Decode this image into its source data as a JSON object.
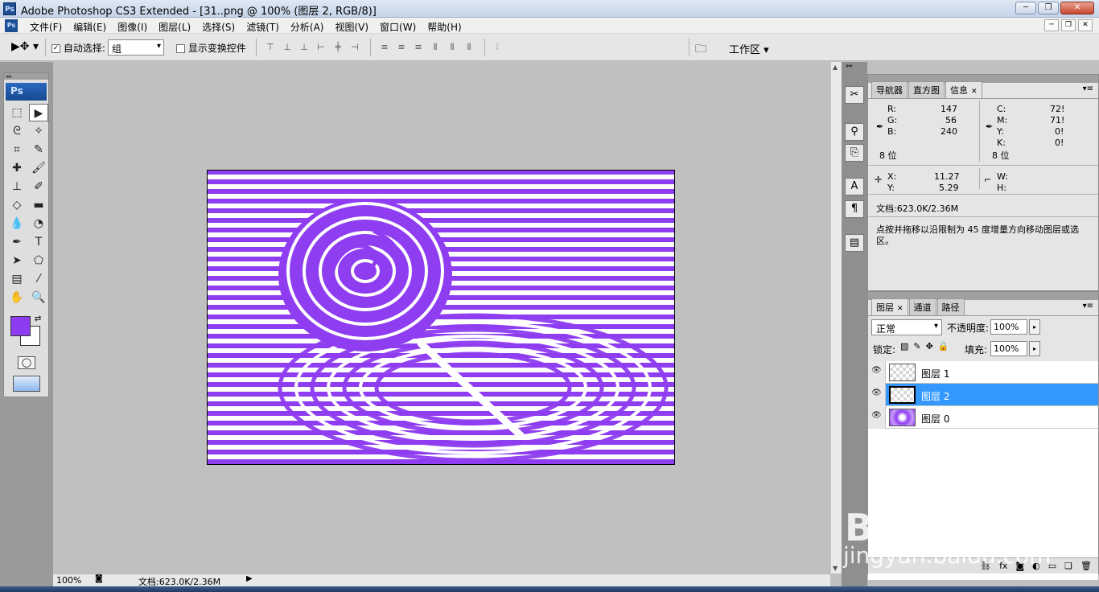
{
  "window": {
    "title": "Adobe Photoshop CS3 Extended - [31..png @ 100% (图层 2, RGB/8)]",
    "app_badge": "Ps",
    "controls": [
      "─",
      "❐",
      "✕"
    ]
  },
  "menu": {
    "items": [
      "文件(F)",
      "编辑(E)",
      "图像(I)",
      "图层(L)",
      "选择(S)",
      "滤镜(T)",
      "分析(A)",
      "视图(V)",
      "窗口(W)",
      "帮助(H)"
    ],
    "mdi_controls": [
      "─",
      "❐",
      "✕"
    ]
  },
  "options": {
    "auto_select_label": "自动选择:",
    "auto_select_value": "组",
    "show_transform_label": "显示变换控件",
    "workspace_label": "工作区 ▾"
  },
  "toolbox": {
    "logo": "Ps"
  },
  "status": {
    "zoom": "100%",
    "doc": "文档:623.0K/2.36M"
  },
  "info_panel": {
    "tabs": [
      "导航器",
      "直方图",
      "信息"
    ],
    "rgb": {
      "R": "147",
      "G": "56",
      "B": "240"
    },
    "cmyk": {
      "C": "72!",
      "M": "71!",
      "Y": "0!",
      "K": "0!"
    },
    "bits_left": "8 位",
    "bits_right": "8 位",
    "x_label": "X:",
    "x_value": "11.27",
    "y_label": "Y:",
    "y_value": "5.29",
    "w_label": "W:",
    "h_label": "H:",
    "doc": "文档:623.0K/2.36M",
    "hint": "点按并拖移以沿限制为 45 度增量方向移动图层或选区。"
  },
  "layers_panel": {
    "tabs": [
      "图层",
      "通道",
      "路径"
    ],
    "blend_mode": "正常",
    "opacity_label": "不透明度:",
    "opacity_value": "100%",
    "lock_label": "锁定:",
    "fill_label": "填充:",
    "fill_value": "100%",
    "layers": [
      {
        "name": "图层 1",
        "selected": false
      },
      {
        "name": "图层 2",
        "selected": true
      },
      {
        "name": "图层 0",
        "selected": false
      }
    ],
    "footer_icons": [
      "⛓",
      "fx",
      "◙",
      "◐",
      "▭",
      "❏",
      "🗑"
    ]
  },
  "watermark": {
    "brand": "Bai du 经验",
    "url": "jingyan.baidu.com"
  },
  "colors": {
    "foreground": "#8d3cf1",
    "canvas_purple": "#8f3df0",
    "selection_blue": "#3399ff"
  }
}
